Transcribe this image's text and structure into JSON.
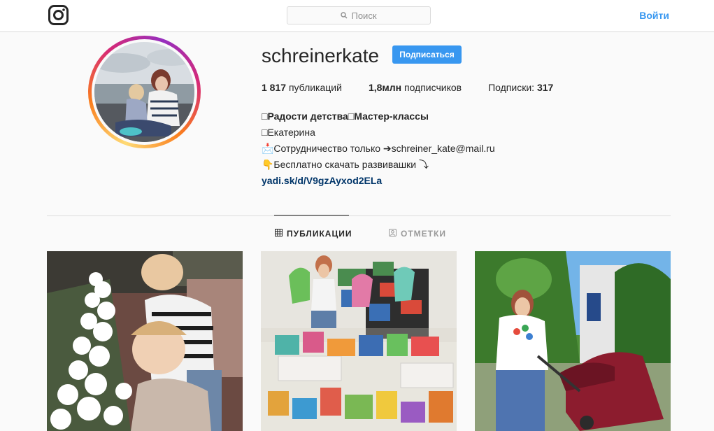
{
  "nav": {
    "search_placeholder": "Поиск",
    "login_label": "Войти"
  },
  "profile": {
    "username": "schreinerkate",
    "follow_label": "Подписаться",
    "stats": {
      "posts_count": "1 817",
      "posts_label": "публикаций",
      "followers_count": "1,8млн",
      "followers_label": "подписчиков",
      "following_label": "Подписки:",
      "following_count": "317"
    },
    "bio": {
      "line1": "Радости детства□Мастер-классы",
      "line1_prefix": "□",
      "line2": "□Екатерина",
      "line3": "📩Сотрудничество только ➔schreiner_kate@mail.ru",
      "line4": "👇Бесплатно скачать развивашки ⤵",
      "link": "yadi.sk/d/V9gzAyxod2ELa"
    }
  },
  "tabs": {
    "posts_label": "ПУБЛИКАЦИИ",
    "tagged_label": "ОТМЕТКИ"
  },
  "colors": {
    "accent": "#3897f0",
    "link": "#003569",
    "border": "#dbdbdb",
    "background": "#fafafa"
  },
  "icons": {
    "logo": "instagram-logo-icon",
    "search": "search-icon",
    "grid": "grid-icon",
    "tagged": "tagged-icon"
  }
}
